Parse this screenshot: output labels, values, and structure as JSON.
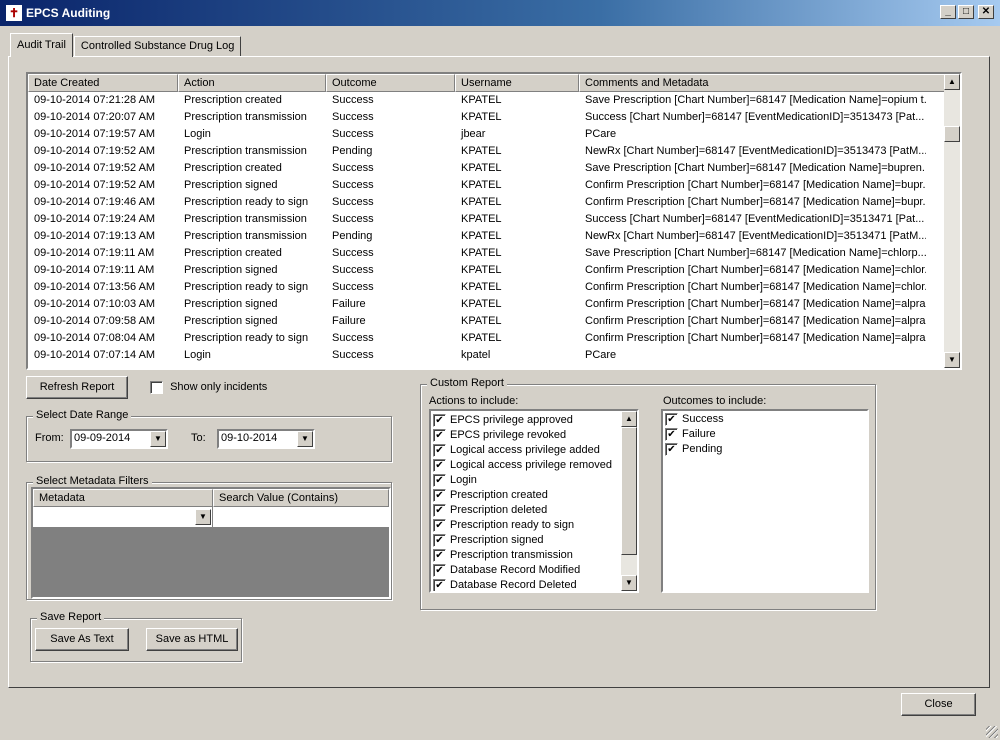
{
  "window": {
    "title": "EPCS Auditing",
    "icon": "app-cross-icon"
  },
  "tabs": [
    {
      "label": "Audit Trail",
      "active": true
    },
    {
      "label": "Controlled Substance Drug Log",
      "active": false
    }
  ],
  "grid": {
    "columns": [
      "Date Created",
      "Action",
      "Outcome",
      "Username",
      "Comments and Metadata"
    ],
    "rows": [
      [
        "09-10-2014 07:21:28 AM",
        "Prescription created",
        "Success",
        "KPATEL",
        "Save Prescription [Chart Number]=68147 [Medication Name]=opium t..."
      ],
      [
        "09-10-2014 07:20:07 AM",
        "Prescription transmission",
        "Success",
        "KPATEL",
        "Success [Chart Number]=68147 [EventMedicationID]=3513473 [Pat..."
      ],
      [
        "09-10-2014 07:19:57 AM",
        "Login",
        "Success",
        "jbear",
        "PCare"
      ],
      [
        "09-10-2014 07:19:52 AM",
        "Prescription transmission",
        "Pending",
        "KPATEL",
        "NewRx [Chart Number]=68147 [EventMedicationID]=3513473 [PatM..."
      ],
      [
        "09-10-2014 07:19:52 AM",
        "Prescription created",
        "Success",
        "KPATEL",
        "Save Prescription [Chart Number]=68147 [Medication Name]=bupren..."
      ],
      [
        "09-10-2014 07:19:52 AM",
        "Prescription signed",
        "Success",
        "KPATEL",
        "Confirm Prescription [Chart Number]=68147 [Medication Name]=bupr..."
      ],
      [
        "09-10-2014 07:19:46 AM",
        "Prescription ready to sign",
        "Success",
        "KPATEL",
        "Confirm Prescription [Chart Number]=68147 [Medication Name]=bupr..."
      ],
      [
        "09-10-2014 07:19:24 AM",
        "Prescription transmission",
        "Success",
        "KPATEL",
        "Success [Chart Number]=68147 [EventMedicationID]=3513471 [Pat..."
      ],
      [
        "09-10-2014 07:19:13 AM",
        "Prescription transmission",
        "Pending",
        "KPATEL",
        "NewRx [Chart Number]=68147 [EventMedicationID]=3513471 [PatM..."
      ],
      [
        "09-10-2014 07:19:11 AM",
        "Prescription created",
        "Success",
        "KPATEL",
        "Save Prescription [Chart Number]=68147 [Medication Name]=chlorp..."
      ],
      [
        "09-10-2014 07:19:11 AM",
        "Prescription signed",
        "Success",
        "KPATEL",
        "Confirm Prescription [Chart Number]=68147 [Medication Name]=chlor..."
      ],
      [
        "09-10-2014 07:13:56 AM",
        "Prescription ready to sign",
        "Success",
        "KPATEL",
        "Confirm Prescription [Chart Number]=68147 [Medication Name]=chlor..."
      ],
      [
        "09-10-2014 07:10:03 AM",
        "Prescription signed",
        "Failure",
        "KPATEL",
        "Confirm Prescription [Chart Number]=68147 [Medication Name]=alpra..."
      ],
      [
        "09-10-2014 07:09:58 AM",
        "Prescription signed",
        "Failure",
        "KPATEL",
        "Confirm Prescription [Chart Number]=68147 [Medication Name]=alpra..."
      ],
      [
        "09-10-2014 07:08:04 AM",
        "Prescription ready to sign",
        "Success",
        "KPATEL",
        "Confirm Prescription [Chart Number]=68147 [Medication Name]=alpra..."
      ],
      [
        "09-10-2014 07:07:14 AM",
        "Login",
        "Success",
        "kpatel",
        "PCare"
      ]
    ]
  },
  "controls": {
    "refresh_label": "Refresh Report",
    "show_incidents_label": "Show only incidents",
    "show_incidents_checked": false
  },
  "date_range": {
    "legend": "Select Date Range",
    "from_label": "From:",
    "from_value": "09-09-2014",
    "to_label": "To:",
    "to_value": "09-10-2014"
  },
  "metadata_filters": {
    "legend": "Select Metadata Filters",
    "col_metadata": "Metadata",
    "col_search": "Search Value (Contains)"
  },
  "save_report": {
    "legend": "Save Report",
    "save_text_label": "Save As Text",
    "save_html_label": "Save as HTML"
  },
  "custom_report": {
    "legend": "Custom Report",
    "actions_label": "Actions to include:",
    "actions": [
      "EPCS privilege approved",
      "EPCS privilege revoked",
      "Logical access privilege added",
      "Logical access privilege removed",
      "Login",
      "Prescription created",
      "Prescription deleted",
      "Prescription ready to sign",
      "Prescription signed",
      "Prescription transmission",
      "Database Record Modified",
      "Database Record Deleted"
    ],
    "outcomes_label": "Outcomes to include:",
    "outcomes": [
      "Success",
      "Failure",
      "Pending"
    ]
  },
  "footer": {
    "close_label": "Close"
  },
  "glyphs": {
    "check": "✔",
    "up": "▲",
    "down": "▼",
    "minimize": "_",
    "maximize": "□",
    "close": "✕",
    "cross": "✝"
  }
}
